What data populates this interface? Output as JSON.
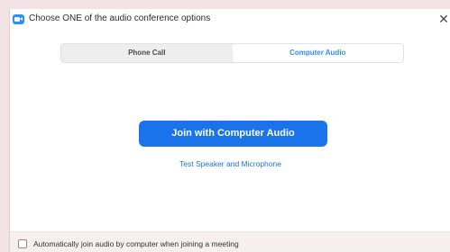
{
  "window": {
    "title": "Choose ONE of the audio conference options",
    "close_icon": "close-icon",
    "app_icon": "zoom-camera-icon"
  },
  "tabs": [
    {
      "label": "Phone Call",
      "selected": false
    },
    {
      "label": "Computer Audio",
      "selected": true
    }
  ],
  "main": {
    "join_label": "Join with Computer Audio",
    "test_label": "Test Speaker and Microphone"
  },
  "footer": {
    "checkbox_label": "Automatically join audio by computer when joining a meeting",
    "checked": false
  },
  "colors": {
    "accent": "#1a73e8",
    "tab_active_text": "#2d8cff",
    "frame": "#f3e3e6"
  }
}
